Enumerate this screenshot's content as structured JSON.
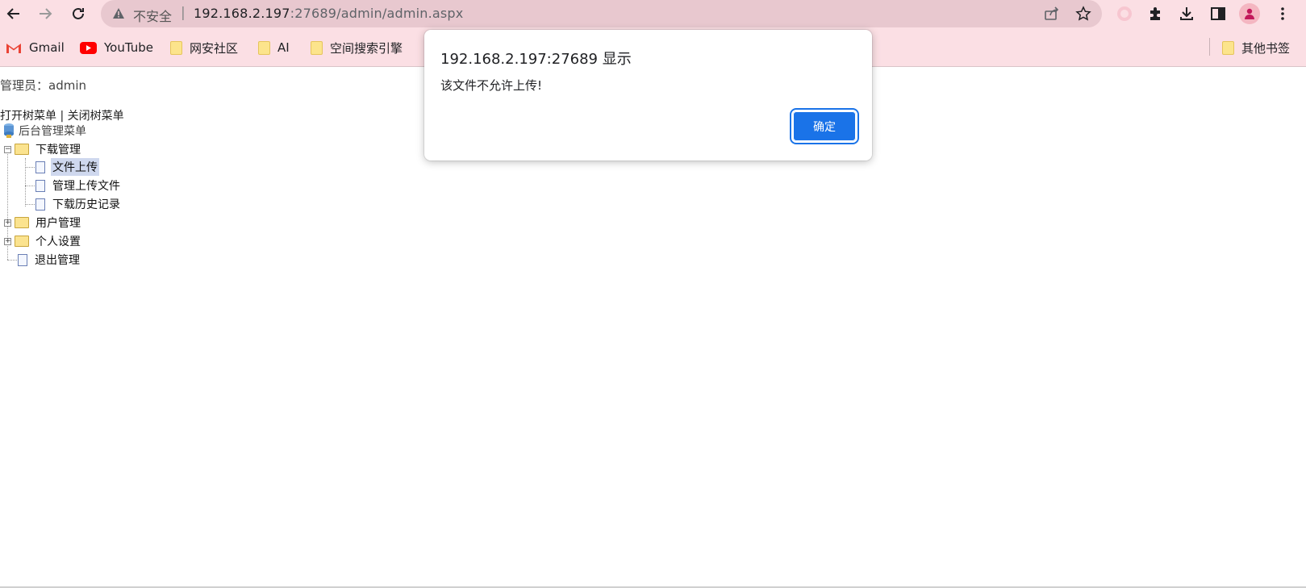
{
  "browser": {
    "security_label": "不安全",
    "url_host": "192.168.2.197",
    "url_path": ":27689/admin/admin.aspx",
    "accent_color": "#1a73e8",
    "chrome_color": "#fbdfe4",
    "avatar_color": "#c2185b"
  },
  "bookmarks": {
    "items": [
      {
        "label": "Gmail",
        "icon": "gmail-icon"
      },
      {
        "label": "YouTube",
        "icon": "youtube-icon"
      },
      {
        "label": "网安社区",
        "icon": "folder-icon"
      },
      {
        "label": "AI",
        "icon": "folder-icon"
      },
      {
        "label": "空间搜索引擎",
        "icon": "folder-icon"
      }
    ],
    "other_label": "其他书签"
  },
  "page": {
    "admin_line": "管理员：admin",
    "open_tree": "打开树菜单",
    "separator": "|",
    "close_tree": "关闭树菜单"
  },
  "tree": {
    "root": "后台管理菜单",
    "download": {
      "label": "下载管理",
      "children": [
        "文件上传",
        "管理上传文件",
        "下载历史记录"
      ]
    },
    "users": "用户管理",
    "personal": "个人设置",
    "logout": "退出管理"
  },
  "dialog": {
    "title": "192.168.2.197:27689 显示",
    "message": "该文件不允许上传!",
    "ok_label": "确定"
  }
}
